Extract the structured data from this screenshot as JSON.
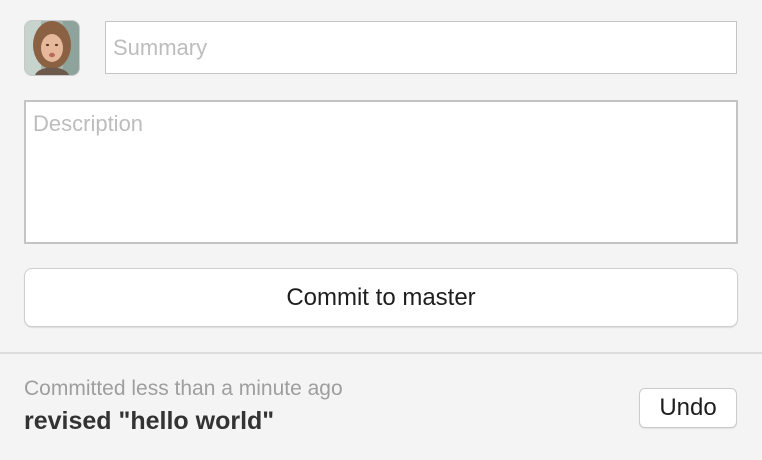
{
  "commit_form": {
    "summary": {
      "placeholder": "Summary",
      "value": ""
    },
    "description": {
      "placeholder": "Description",
      "value": ""
    },
    "commit_button_label": "Commit to master",
    "avatar_icon": "user-avatar"
  },
  "last_commit": {
    "time_text": "Committed less than a minute ago",
    "message": "revised \"hello world\"",
    "undo_label": "Undo"
  }
}
